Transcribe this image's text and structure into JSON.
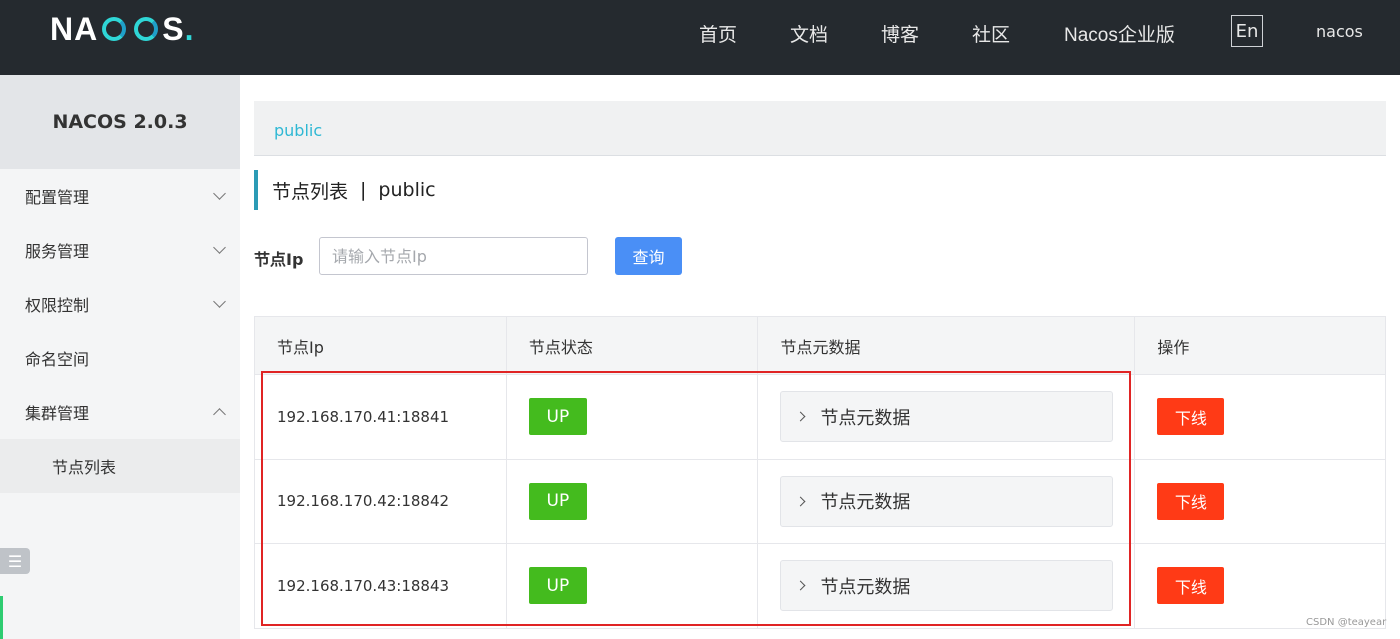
{
  "header": {
    "logo_text": "NACOS",
    "nav": {
      "home": "首页",
      "docs": "文档",
      "blog": "博客",
      "community": "社区",
      "enterprise": "Nacos企业版"
    },
    "language": "En",
    "user": "nacos"
  },
  "sidebar": {
    "title": "NACOS 2.0.3",
    "items": [
      {
        "label": "配置管理"
      },
      {
        "label": "服务管理"
      },
      {
        "label": "权限控制"
      },
      {
        "label": "命名空间"
      },
      {
        "label": "集群管理"
      }
    ],
    "sub_items": [
      {
        "label": "节点列表"
      }
    ]
  },
  "namespace": {
    "current": "public"
  },
  "page": {
    "title": "节点列表",
    "separator": "|",
    "namespace": "public"
  },
  "filter": {
    "label": "节点Ip",
    "placeholder": "请输入节点Ip",
    "query_label": "查询"
  },
  "table": {
    "headers": [
      "节点Ip",
      "节点状态",
      "节点元数据",
      "操作"
    ],
    "rows": [
      {
        "ip": "192.168.170.41:18841",
        "status": "UP",
        "metadata": "节点元数据",
        "action": "下线"
      },
      {
        "ip": "192.168.170.42:18842",
        "status": "UP",
        "metadata": "节点元数据",
        "action": "下线"
      },
      {
        "ip": "192.168.170.43:18843",
        "status": "UP",
        "metadata": "节点元数据",
        "action": "下线"
      }
    ]
  },
  "watermark": "CSDN @teayear",
  "colors": {
    "header_bg": "#252a2f",
    "primary": "#4a8ff6",
    "up": "#44bb1e",
    "danger": "#ff3a16",
    "link": "#2fb8d4"
  }
}
